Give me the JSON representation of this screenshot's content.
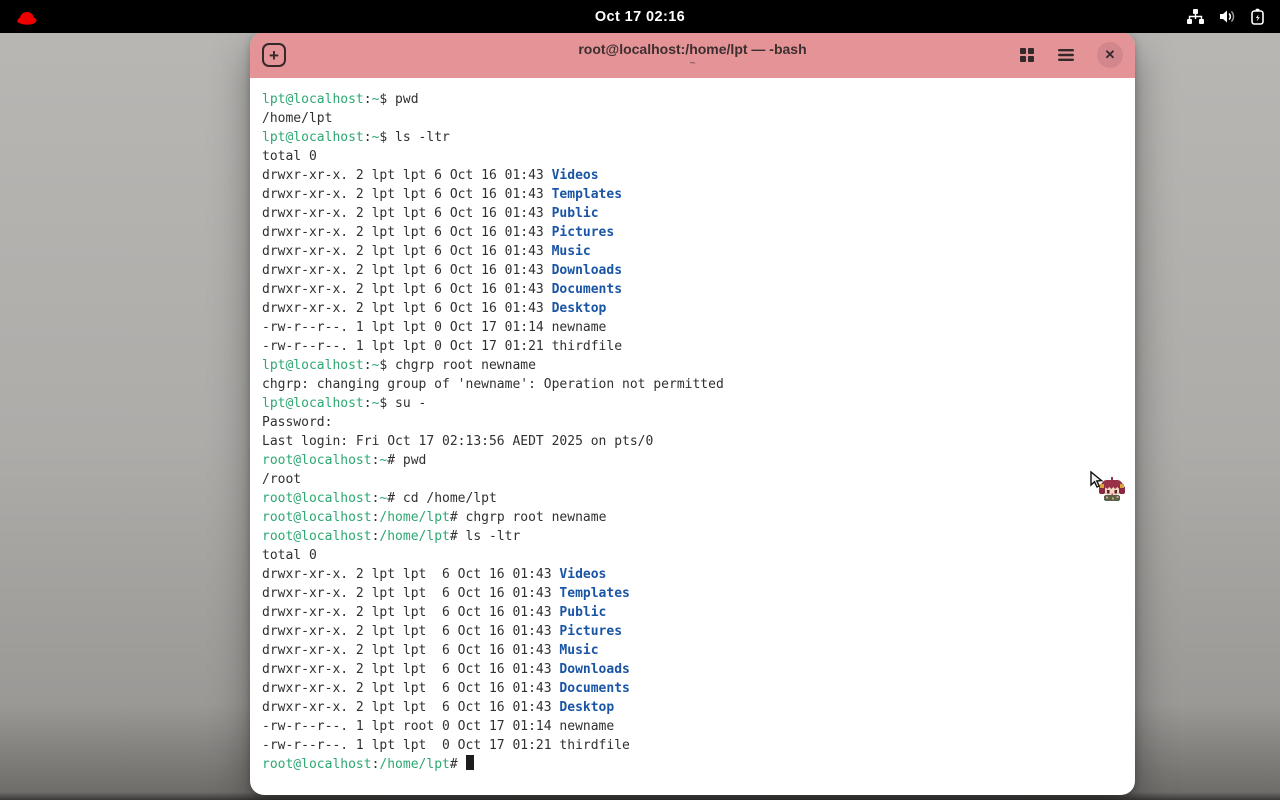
{
  "top_bar": {
    "clock": "Oct 17 02:16",
    "icons": [
      "redhat-logo-icon",
      "wired-network-icon",
      "volume-icon",
      "battery-charging-icon"
    ]
  },
  "window": {
    "title": "root@localhost:/home/lpt — -bash",
    "subtitle": "~",
    "new_tab_label": "+",
    "close_label": "✕"
  },
  "colors": {
    "titlebar": "#e49496",
    "close_circle": "#d2878c",
    "prompt_green": "#2da871",
    "dir_blue": "#1a55a5",
    "foreground": "#303030",
    "terminal_bg": "#ffffff",
    "topbar_bg": "#000000"
  },
  "terminal": {
    "lines": [
      [
        {
          "t": "lpt@localhost",
          "c": "g"
        },
        {
          "t": ":",
          "c": "f"
        },
        {
          "t": "~",
          "c": "g"
        },
        {
          "t": "$ pwd",
          "c": "f"
        }
      ],
      [
        {
          "t": "/home/lpt",
          "c": "f"
        }
      ],
      [
        {
          "t": "lpt@localhost",
          "c": "g"
        },
        {
          "t": ":",
          "c": "f"
        },
        {
          "t": "~",
          "c": "g"
        },
        {
          "t": "$ ls -ltr",
          "c": "f"
        }
      ],
      [
        {
          "t": "total 0",
          "c": "f"
        }
      ],
      [
        {
          "t": "drwxr-xr-x. 2 lpt lpt 6 Oct 16 01:43 ",
          "c": "f"
        },
        {
          "t": "Videos",
          "c": "b"
        }
      ],
      [
        {
          "t": "drwxr-xr-x. 2 lpt lpt 6 Oct 16 01:43 ",
          "c": "f"
        },
        {
          "t": "Templates",
          "c": "b"
        }
      ],
      [
        {
          "t": "drwxr-xr-x. 2 lpt lpt 6 Oct 16 01:43 ",
          "c": "f"
        },
        {
          "t": "Public",
          "c": "b"
        }
      ],
      [
        {
          "t": "drwxr-xr-x. 2 lpt lpt 6 Oct 16 01:43 ",
          "c": "f"
        },
        {
          "t": "Pictures",
          "c": "b"
        }
      ],
      [
        {
          "t": "drwxr-xr-x. 2 lpt lpt 6 Oct 16 01:43 ",
          "c": "f"
        },
        {
          "t": "Music",
          "c": "b"
        }
      ],
      [
        {
          "t": "drwxr-xr-x. 2 lpt lpt 6 Oct 16 01:43 ",
          "c": "f"
        },
        {
          "t": "Downloads",
          "c": "b"
        }
      ],
      [
        {
          "t": "drwxr-xr-x. 2 lpt lpt 6 Oct 16 01:43 ",
          "c": "f"
        },
        {
          "t": "Documents",
          "c": "b"
        }
      ],
      [
        {
          "t": "drwxr-xr-x. 2 lpt lpt 6 Oct 16 01:43 ",
          "c": "f"
        },
        {
          "t": "Desktop",
          "c": "b"
        }
      ],
      [
        {
          "t": "-rw-r--r--. 1 lpt lpt 0 Oct 17 01:14 newname",
          "c": "f"
        }
      ],
      [
        {
          "t": "-rw-r--r--. 1 lpt lpt 0 Oct 17 01:21 thirdfile",
          "c": "f"
        }
      ],
      [
        {
          "t": "lpt@localhost",
          "c": "g"
        },
        {
          "t": ":",
          "c": "f"
        },
        {
          "t": "~",
          "c": "g"
        },
        {
          "t": "$ chgrp root newname",
          "c": "f"
        }
      ],
      [
        {
          "t": "chgrp: changing group of 'newname': Operation not permitted",
          "c": "f"
        }
      ],
      [
        {
          "t": "lpt@localhost",
          "c": "g"
        },
        {
          "t": ":",
          "c": "f"
        },
        {
          "t": "~",
          "c": "g"
        },
        {
          "t": "$ su -",
          "c": "f"
        }
      ],
      [
        {
          "t": "Password:",
          "c": "f"
        }
      ],
      [
        {
          "t": "Last login: Fri Oct 17 02:13:56 AEDT 2025 on pts/0",
          "c": "f"
        }
      ],
      [
        {
          "t": "root@localhost",
          "c": "g"
        },
        {
          "t": ":",
          "c": "f"
        },
        {
          "t": "~",
          "c": "g"
        },
        {
          "t": "# pwd",
          "c": "f"
        }
      ],
      [
        {
          "t": "/root",
          "c": "f"
        }
      ],
      [
        {
          "t": "root@localhost",
          "c": "g"
        },
        {
          "t": ":",
          "c": "f"
        },
        {
          "t": "~",
          "c": "g"
        },
        {
          "t": "# cd /home/lpt",
          "c": "f"
        }
      ],
      [
        {
          "t": "root@localhost",
          "c": "g"
        },
        {
          "t": ":",
          "c": "f"
        },
        {
          "t": "/home/lpt",
          "c": "g"
        },
        {
          "t": "# chgrp root newname",
          "c": "f"
        }
      ],
      [
        {
          "t": "root@localhost",
          "c": "g"
        },
        {
          "t": ":",
          "c": "f"
        },
        {
          "t": "/home/lpt",
          "c": "g"
        },
        {
          "t": "# ls -ltr",
          "c": "f"
        }
      ],
      [
        {
          "t": "total 0",
          "c": "f"
        }
      ],
      [
        {
          "t": "drwxr-xr-x. 2 lpt lpt  6 Oct 16 01:43 ",
          "c": "f"
        },
        {
          "t": "Videos",
          "c": "b"
        }
      ],
      [
        {
          "t": "drwxr-xr-x. 2 lpt lpt  6 Oct 16 01:43 ",
          "c": "f"
        },
        {
          "t": "Templates",
          "c": "b"
        }
      ],
      [
        {
          "t": "drwxr-xr-x. 2 lpt lpt  6 Oct 16 01:43 ",
          "c": "f"
        },
        {
          "t": "Public",
          "c": "b"
        }
      ],
      [
        {
          "t": "drwxr-xr-x. 2 lpt lpt  6 Oct 16 01:43 ",
          "c": "f"
        },
        {
          "t": "Pictures",
          "c": "b"
        }
      ],
      [
        {
          "t": "drwxr-xr-x. 2 lpt lpt  6 Oct 16 01:43 ",
          "c": "f"
        },
        {
          "t": "Music",
          "c": "b"
        }
      ],
      [
        {
          "t": "drwxr-xr-x. 2 lpt lpt  6 Oct 16 01:43 ",
          "c": "f"
        },
        {
          "t": "Downloads",
          "c": "b"
        }
      ],
      [
        {
          "t": "drwxr-xr-x. 2 lpt lpt  6 Oct 16 01:43 ",
          "c": "f"
        },
        {
          "t": "Documents",
          "c": "b"
        }
      ],
      [
        {
          "t": "drwxr-xr-x. 2 lpt lpt  6 Oct 16 01:43 ",
          "c": "f"
        },
        {
          "t": "Desktop",
          "c": "b"
        }
      ],
      [
        {
          "t": "-rw-r--r--. 1 lpt root 0 Oct 17 01:14 newname",
          "c": "f"
        }
      ],
      [
        {
          "t": "-rw-r--r--. 1 lpt lpt  0 Oct 17 01:21 thirdfile",
          "c": "f"
        }
      ],
      [
        {
          "t": "root@localhost",
          "c": "g"
        },
        {
          "t": ":",
          "c": "f"
        },
        {
          "t": "/home/lpt",
          "c": "g"
        },
        {
          "t": "# ",
          "c": "f"
        },
        {
          "t": "",
          "c": "cursor"
        }
      ]
    ]
  }
}
